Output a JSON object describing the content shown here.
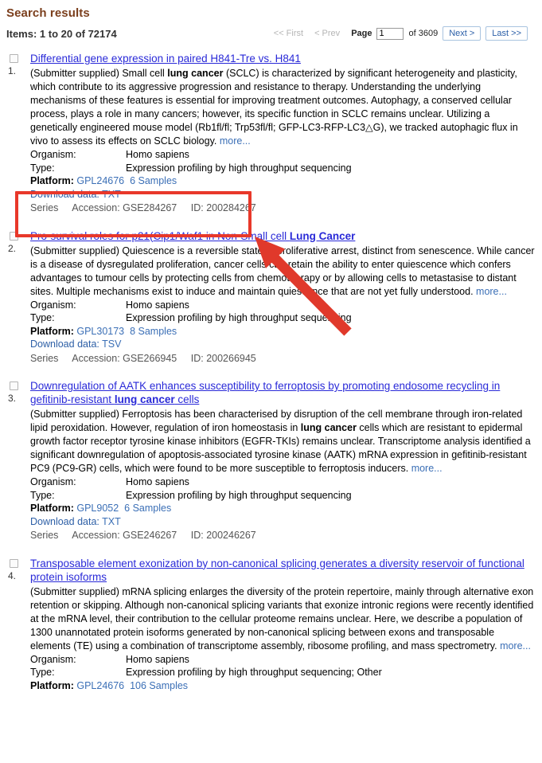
{
  "header": {
    "title": "Search results",
    "items_count": "Items: 1 to 20 of 72174"
  },
  "pager": {
    "first": "<< First",
    "prev": "< Prev",
    "page_label": "Page",
    "page_value": "1",
    "of_total": "of 3609",
    "next": "Next >",
    "last": "Last >>"
  },
  "labels": {
    "organism": "Organism:",
    "type": "Type:",
    "platform": "Platform:",
    "download": "Download data:",
    "series": "Series",
    "more": "more..."
  },
  "results": [
    {
      "rank": "1.",
      "title_pre": "Differential gene expression in paired H841-Tre vs. H841",
      "title_bold": "",
      "title_post": "",
      "summary": "(Submitter supplied) Small cell ",
      "summary_bold": "lung cancer",
      "summary_rest": " (SCLC) is characterized by significant heterogeneity and plasticity, which contribute to its aggressive progression and resistance to therapy. Understanding the underlying mechanisms of these features is essential for improving treatment outcomes. Autophagy, a conserved cellular process, plays a role in many cancers; however, its specific function in SCLC remains unclear. Utilizing a genetically engineered mouse model (Rb1fl/fl; Trp53fl/fl; GFP-LC3-RFP-LC3△G), we tracked autophagic flux in vivo to assess its effects on SCLC biology. ",
      "organism": "Homo sapiens",
      "type": "Expression profiling by high throughput sequencing",
      "platform_id": "GPL24676",
      "samples": "6 Samples",
      "download_format": "TXT",
      "accession": "Accession: GSE284267",
      "id": "ID: 200284267"
    },
    {
      "rank": "2.",
      "title_pre": "Pro-survival roles for p21(Cip1/Waf1 in Non-Small cell ",
      "title_bold": "Lung Cancer",
      "title_post": "",
      "summary": "(Submitter supplied) Quiescence is a reversible state of proliferative arrest, distinct from senescence. While cancer is a disease of dysregulated proliferation, cancer cells can retain the ability to enter quiescence which confers advantages to tumour cells by protecting cells from chemotherapy or by allowing cells to metastasise to distant sites. Multiple mechanisms exist to induce and maintain quiescence that are not yet fully understood. ",
      "summary_bold": "",
      "summary_rest": "",
      "organism": "Homo sapiens",
      "type": "Expression profiling by high throughput sequencing",
      "platform_id": "GPL30173",
      "samples": "8 Samples",
      "download_format": "TSV",
      "accession": "Accession: GSE266945",
      "id": "ID: 200266945"
    },
    {
      "rank": "3.",
      "title_pre": "Downregulation of AATK enhances susceptibility to ferroptosis by promoting endosome recycling in gefitinib-resistant ",
      "title_bold": "lung cancer",
      "title_post": " cells",
      "summary": "(Submitter supplied) Ferroptosis has been characterised by disruption of the cell membrane through iron-related lipid peroxidation. However, regulation of iron homeostasis in ",
      "summary_bold": "lung cancer",
      "summary_rest": " cells which are resistant to epidermal growth factor receptor tyrosine kinase inhibitors (EGFR-TKIs) remains unclear. Transcriptome analysis identified a significant downregulation of apoptosis-associated tyrosine kinase (AATK) mRNA expression in gefitinib-resistant PC9 (PC9-GR) cells, which were found to be more susceptible to ferroptosis inducers. ",
      "organism": "Homo sapiens",
      "type": "Expression profiling by high throughput sequencing",
      "platform_id": "GPL9052",
      "samples": "6 Samples",
      "download_format": "TXT",
      "accession": "Accession: GSE246267",
      "id": "ID: 200246267"
    },
    {
      "rank": "4.",
      "title_pre": "Transposable element exonization by non-canonical splicing generates a diversity reservoir of functional protein isoforms",
      "title_bold": "",
      "title_post": "",
      "summary": "(Submitter supplied) mRNA splicing enlarges the diversity of the protein repertoire, mainly through alternative exon retention or skipping. Although non-canonical splicing variants that exonize intronic regions were recently identified at the mRNA level, their contribution to the cellular proteome remains unclear. Here, we describe a population of 1300 unannotated protein isoforms generated by non-canonical splicing between exons and transposable elements (TE) using a combination of transcriptome assembly, ribosome profiling, and mass spectrometry. ",
      "summary_bold": "",
      "summary_rest": "",
      "organism": "Homo sapiens",
      "type": "Expression profiling by high throughput sequencing; Other",
      "platform_id": "GPL24676",
      "samples": "106 Samples",
      "download_format": "",
      "accession": "",
      "id": ""
    }
  ],
  "annotation": {
    "highlight_color": "#e8382a",
    "arrow_color": "#e0392b"
  }
}
